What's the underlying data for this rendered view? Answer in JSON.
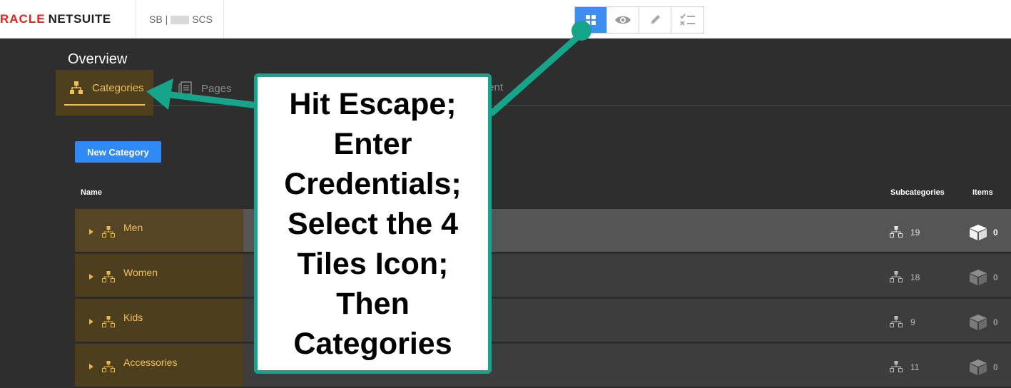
{
  "header": {
    "logo_left": "RACLE",
    "logo_right": "NETSUITE",
    "account_prefix": "SB |",
    "account_suffix": "SCS",
    "mode_buttons": [
      {
        "icon": "four-tiles-icon",
        "active": true
      },
      {
        "icon": "eye-icon",
        "active": false
      },
      {
        "icon": "pencil-icon",
        "active": false
      },
      {
        "icon": "checklist-icon",
        "active": false
      }
    ]
  },
  "main": {
    "title": "Overview",
    "tabs": [
      {
        "label": "Categories",
        "icon": "category-tree-icon",
        "active": true
      },
      {
        "label": "Pages",
        "icon": "pages-icon",
        "active": false
      },
      {
        "label": "tent",
        "icon": "",
        "active": false
      }
    ],
    "new_button": "New Category",
    "columns": {
      "name": "Name",
      "subcategories": "Subcategories",
      "items": "Items"
    },
    "rows": [
      {
        "name": "Men",
        "subcategories": "19",
        "items": "0"
      },
      {
        "name": "Women",
        "subcategories": "18",
        "items": "0"
      },
      {
        "name": "Kids",
        "subcategories": "9",
        "items": "0"
      },
      {
        "name": "Accessories",
        "subcategories": "11",
        "items": "0"
      }
    ]
  },
  "annotation": {
    "text": "Hit Escape;\nEnter\nCredentials;\nSelect the 4\nTiles Icon;\nThen\nCategories",
    "color": "#16a58a"
  }
}
